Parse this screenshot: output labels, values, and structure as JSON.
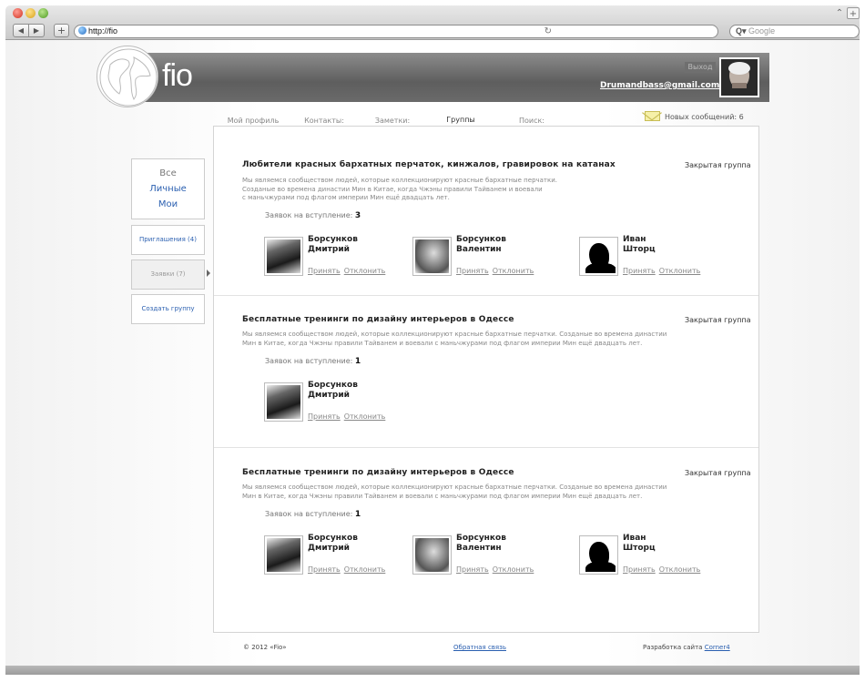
{
  "browser": {
    "url": "http://fio",
    "search_placeholder": "Google",
    "reload_icon": "reload-icon",
    "back_label": "◀",
    "forward_label": "▶",
    "add_label": "+",
    "resize_label": "⌃",
    "new_tab_label": "+"
  },
  "header": {
    "logo_text": "fio",
    "logout_label": "Выход",
    "email": "Drumandbass@gmail.com"
  },
  "tabs": [
    {
      "label": "Мой профиль",
      "active": false
    },
    {
      "label": "Контакты:",
      "active": false
    },
    {
      "label": "Заметки:",
      "active": false
    },
    {
      "label": "Группы",
      "active": true
    },
    {
      "label": "Поиск:",
      "active": false
    }
  ],
  "messages": {
    "label": "Новых сообщений: 6"
  },
  "sidebar": {
    "filters": {
      "all": "Все",
      "personal": "Личные",
      "mine": "Мои"
    },
    "invitations": "Приглашения (4)",
    "requests": "Заявки (7)",
    "create": "Создать группу"
  },
  "groups": [
    {
      "title": "Любители красных бархатных перчаток, кинжалов, гравировок на катанах",
      "type": "Закрытая группа",
      "desc_lines": [
        "Мы являемся сообществом людей, которые коллекционируют красные бархатные перчатки.",
        "Созданые во времена династии Мин в Китае, когда Чжэны правили Тайванем и воевали",
        "с маньчжурами под флагом империи Мин ещё двадцать лет."
      ],
      "count_label": "Заявок на вступление:",
      "count": "3",
      "people": [
        {
          "first": "Борсунков",
          "second": "Дмитрий",
          "accept": "Принять",
          "decline": "Отклонить"
        },
        {
          "first": "Борсунков",
          "second": "Валентин",
          "accept": "Принять",
          "decline": "Отклонить"
        },
        {
          "first": "Иван",
          "second": "Шторц",
          "accept": "Принять",
          "decline": "Отклонить"
        }
      ]
    },
    {
      "title": "Бесплатные тренинги по дизайну интерьеров в Одессе",
      "type": "Закрытая группа",
      "desc_lines": [
        "Мы являемся сообществом людей, которые коллекционируют красные бархатные перчатки. Созданые во времена династии",
        "Мин в Китае, когда Чжэны правили Тайванем и воевали с маньчжурами под флагом империи Мин ещё двадцать лет."
      ],
      "count_label": "Заявок на вступление:",
      "count": "1",
      "people": [
        {
          "first": "Борсунков",
          "second": "Дмитрий",
          "accept": "Принять",
          "decline": "Отклонить"
        }
      ]
    },
    {
      "title": "Бесплатные тренинги по дизайну интерьеров в Одессе",
      "type": "Закрытая группа",
      "desc_lines": [
        "Мы являемся сообществом людей, которые коллекционируют красные бархатные перчатки. Созданые во времена династии",
        "Мин в Китае, когда Чжэны правили Тайванем и воевали с маньчжурами под флагом империи Мин ещё двадцать лет."
      ],
      "count_label": "Заявок на вступление:",
      "count": "1",
      "people": [
        {
          "first": "Борсунков",
          "second": "Дмитрий",
          "accept": "Принять",
          "decline": "Отклонить"
        },
        {
          "first": "Борсунков",
          "second": "Валентин",
          "accept": "Принять",
          "decline": "Отклонить"
        },
        {
          "first": "Иван",
          "second": "Шторц",
          "accept": "Принять",
          "decline": "Отклонить"
        }
      ]
    }
  ],
  "footer": {
    "copyright": "© 2012 «Fio»",
    "feedback": "Обратная связь",
    "dev_prefix": "Разработка сайта",
    "dev_link": "Corner4"
  },
  "colors": {
    "accent_link": "#2a5fb0",
    "header_gray": "#6a6a6a"
  }
}
